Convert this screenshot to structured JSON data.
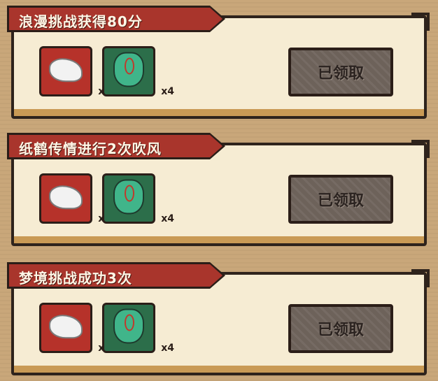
{
  "tasks": [
    {
      "title": "浪漫挑战获得80分",
      "rewards": [
        {
          "icon": "cloth-icon",
          "count": "x2"
        },
        {
          "icon": "pouch-icon",
          "count": "x4"
        }
      ],
      "button_label": "已领取"
    },
    {
      "title": "纸鹤传情进行2次吹风",
      "rewards": [
        {
          "icon": "cloth-icon",
          "count": "x2"
        },
        {
          "icon": "pouch-icon",
          "count": "x4"
        }
      ],
      "button_label": "已领取"
    },
    {
      "title": "梦境挑战成功3次",
      "rewards": [
        {
          "icon": "cloth-icon",
          "count": "x2"
        },
        {
          "icon": "pouch-icon",
          "count": "x4"
        }
      ],
      "button_label": "已领取"
    }
  ],
  "colors": {
    "banner": "#a9352c",
    "panel": "#f6ecd3",
    "button_disabled": "#6d625a"
  }
}
